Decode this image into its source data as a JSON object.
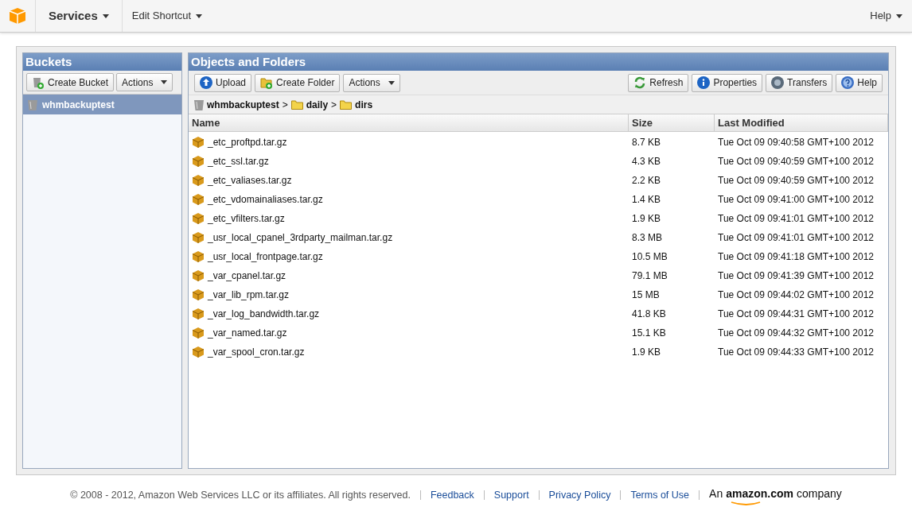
{
  "top_nav": {
    "menus": [
      {
        "label": "Services",
        "kind": "primary"
      },
      {
        "label": "Edit Shortcut",
        "kind": "secondary"
      }
    ],
    "help": "Help"
  },
  "buckets_panel": {
    "title": "Buckets",
    "buttons": [
      {
        "label": "Create Bucket",
        "kind": "create-bucket"
      },
      {
        "label": "Actions",
        "kind": "dropdown"
      }
    ],
    "items": [
      {
        "label": "whmbackuptest",
        "selected": true
      }
    ]
  },
  "objects_panel": {
    "title": "Objects and Folders",
    "left_buttons": [
      {
        "label": "Upload",
        "kind": "upload"
      },
      {
        "label": "Create Folder",
        "kind": "create-folder"
      },
      {
        "label": "Actions",
        "kind": "dropdown"
      }
    ],
    "right_buttons": [
      {
        "label": "Refresh",
        "kind": "refresh"
      },
      {
        "label": "Properties",
        "kind": "info"
      },
      {
        "label": "Transfers",
        "kind": "transfers"
      },
      {
        "label": "Help",
        "kind": "help"
      }
    ],
    "breadcrumb": [
      {
        "label": "whmbackuptest",
        "kind": "bucket"
      },
      {
        "separator": ">",
        "label": "daily",
        "kind": "folder"
      },
      {
        "separator": ">",
        "label": "dirs",
        "kind": "folder"
      }
    ],
    "table": {
      "columns": [
        "Name",
        "Size",
        "Last Modified"
      ],
      "rows": [
        [
          "_etc_proftpd.tar.gz",
          "8.7 KB",
          "Tue Oct 09 09:40:58 GMT+100 2012"
        ],
        [
          "_etc_ssl.tar.gz",
          "4.3 KB",
          "Tue Oct 09 09:40:59 GMT+100 2012"
        ],
        [
          "_etc_valiases.tar.gz",
          "2.2 KB",
          "Tue Oct 09 09:40:59 GMT+100 2012"
        ],
        [
          "_etc_vdomainaliases.tar.gz",
          "1.4 KB",
          "Tue Oct 09 09:41:00 GMT+100 2012"
        ],
        [
          "_etc_vfilters.tar.gz",
          "1.9 KB",
          "Tue Oct 09 09:41:01 GMT+100 2012"
        ],
        [
          "_usr_local_cpanel_3rdparty_mailman.tar.gz",
          "8.3 MB",
          "Tue Oct 09 09:41:01 GMT+100 2012"
        ],
        [
          "_usr_local_frontpage.tar.gz",
          "10.5 MB",
          "Tue Oct 09 09:41:18 GMT+100 2012"
        ],
        [
          "_var_cpanel.tar.gz",
          "79.1 MB",
          "Tue Oct 09 09:41:39 GMT+100 2012"
        ],
        [
          "_var_lib_rpm.tar.gz",
          "15 MB",
          "Tue Oct 09 09:44:02 GMT+100 2012"
        ],
        [
          "_var_log_bandwidth.tar.gz",
          "41.8 KB",
          "Tue Oct 09 09:44:31 GMT+100 2012"
        ],
        [
          "_var_named.tar.gz",
          "15.1 KB",
          "Tue Oct 09 09:44:32 GMT+100 2012"
        ],
        [
          "_var_spool_cron.tar.gz",
          "1.9 KB",
          "Tue Oct 09 09:44:33 GMT+100 2012"
        ]
      ]
    }
  },
  "footer": {
    "copyright": "© 2008 - 2012, Amazon Web Services LLC or its affiliates. All rights reserved.",
    "links": [
      "Feedback",
      "Support",
      "Privacy Policy",
      "Terms of Use"
    ],
    "brand": {
      "prefix": "An",
      "name": "amazon.com",
      "suffix": "company"
    }
  }
}
